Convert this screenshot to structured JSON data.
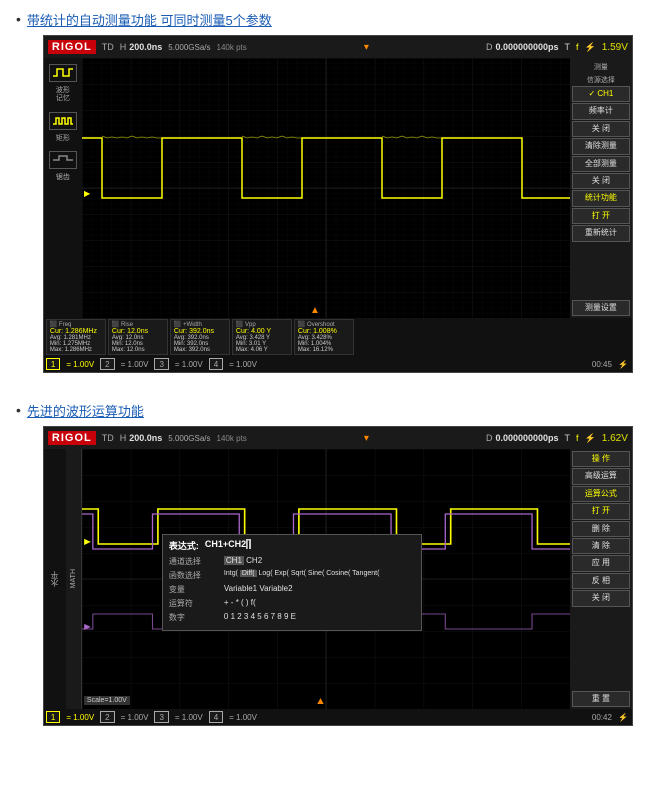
{
  "section1": {
    "bullet": "•",
    "title": "带统计的自动测量功能 可同时测量5个参数",
    "scope": {
      "logo": "RIGOL",
      "mode": "TD",
      "timebase_label": "H",
      "timebase_val": "200.0ns",
      "sample_rate": "5.000GSa/s",
      "sample_pts": "140k pts",
      "trigger_label": "D",
      "trigger_val": "0.000000000ps",
      "trigger_icon": "T",
      "ch1_label": "f",
      "voltage": "1.59V",
      "ch1_scale": "= 1.00V",
      "ch2_scale": "= 1.00V",
      "ch3_scale": "= 1.00V",
      "ch4_scale": "= 1.00V",
      "time_display": "00:45",
      "sidebar_items": [
        {
          "label": "信源选择",
          "sub": "✓ CH1"
        },
        {
          "label": "频率计",
          "sub": "关 闭"
        },
        {
          "label": "清除测量"
        },
        {
          "label": "全部测量",
          "sub": "关 闭"
        },
        {
          "label": "统计功能",
          "sub": "打 开"
        },
        {
          "label": "重新统计"
        },
        {
          "label": "测量设置"
        }
      ],
      "measurements": [
        {
          "name": "Freq",
          "cur": "1.286MHz",
          "avg": "1.281MHz",
          "min": "1.275MHz",
          "max": "1.286MHz"
        },
        {
          "name": "Rise",
          "cur": "12.0ns",
          "avg": "12.0ns",
          "min": "12.0ns",
          "max": "12.0ns"
        },
        {
          "name": "+Width",
          "cur": "392.0ns",
          "avg": "392.0ns",
          "min": "392.0ns",
          "max": "392.0ns"
        },
        {
          "name": "Vpp",
          "cur": "4.00Y",
          "avg": "3.428Y",
          "min": "3.01Y",
          "max": "4.06Y"
        },
        {
          "name": "Overshoot",
          "cur": "1.008%",
          "avg": "3.428%",
          "min": "1.004%",
          "max": "16.12%"
        }
      ]
    }
  },
  "section2": {
    "bullet": "•",
    "title": "先进的波形运算功能",
    "scope": {
      "logo": "RIGOL",
      "mode": "TD",
      "timebase_label": "H",
      "timebase_val": "200.0ns",
      "sample_rate": "5.000GSa/s",
      "sample_pts": "140k pts",
      "trigger_label": "D",
      "trigger_val": "0.000000000ps",
      "trigger_icon": "T",
      "ch1_label": "f",
      "voltage": "1.62V",
      "ch1_scale": "= 1.00V",
      "ch2_scale": "= 1.00V",
      "ch3_scale": "= 1.00V",
      "ch4_scale": "= 1.00V",
      "time_display": "00:42",
      "left_label": "水平",
      "math_label": "MATH",
      "math_scale": "Scale=1.00V",
      "sidebar_items": [
        {
          "label": "操作",
          "sub": "高级运算"
        },
        {
          "label": "运算公式",
          "sub": "打 开"
        },
        {
          "label": "删 除"
        },
        {
          "label": "清 除"
        },
        {
          "label": "应 用"
        },
        {
          "label": "反 相",
          "sub": "关 闭"
        },
        {
          "label": "重 置"
        }
      ],
      "popup": {
        "title": "表达式",
        "title_val": "CH1+CH2",
        "row1_label": "通道选择",
        "row1_val": "CH1 CH2",
        "row2_label": "函数选择",
        "row2_val": "Intg( Diff( Log( Exp( Sqrt( Sine( Cosine( Tangent(",
        "row3_label": "变量",
        "row3_val": "Variable1 Variable2",
        "row4_label": "运算符",
        "row4_val": "+ - * ( ) f(",
        "row5_label": "数字",
        "row5_val": "0 1 2 3 4 5 6 7 8 9 E"
      }
    }
  }
}
